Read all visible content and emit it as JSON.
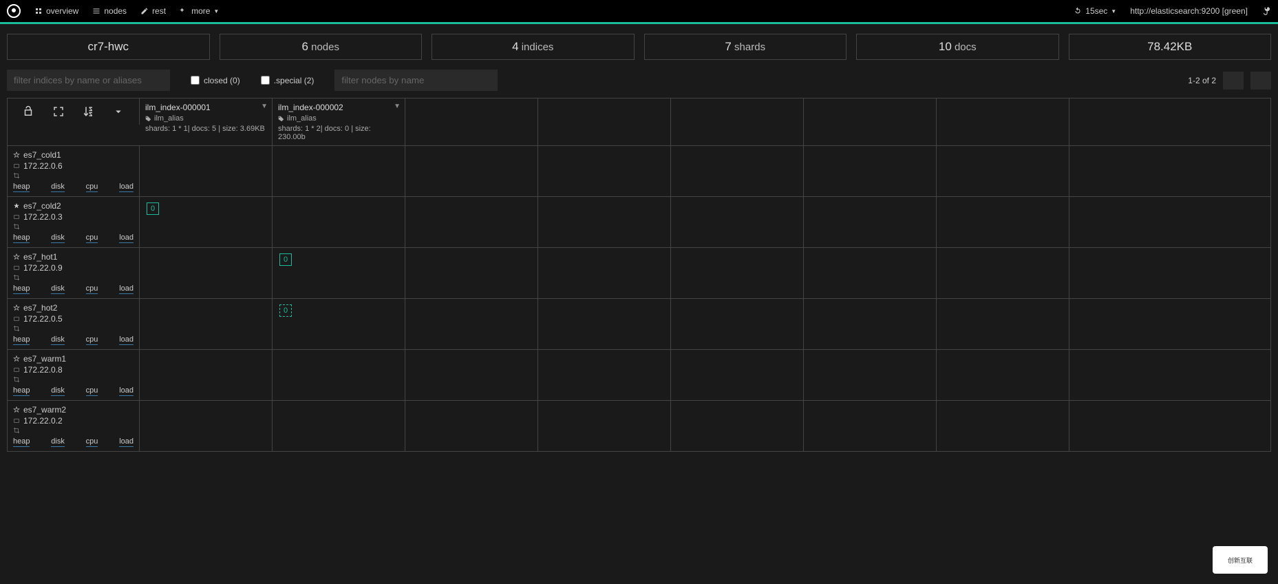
{
  "nav": {
    "overview": "overview",
    "nodes": "nodes",
    "rest": "rest",
    "more": "more",
    "refresh": "15sec",
    "host": "http://elasticsearch:9200 [green]"
  },
  "cluster": {
    "name": "cr7-hwc",
    "nodes_count": "6",
    "nodes_label": "nodes",
    "indices_count": "4",
    "indices_label": "indices",
    "shards_count": "7",
    "shards_label": "shards",
    "docs_count": "10",
    "docs_label": "docs",
    "size": "78.42KB"
  },
  "filters": {
    "indices_placeholder": "filter indices by name or aliases",
    "nodes_placeholder": "filter nodes by name",
    "closed_label": "closed (0)",
    "special_label": ".special (2)",
    "pagination": "1-2 of 2"
  },
  "indices": [
    {
      "name": "ilm_index-000001",
      "alias": "ilm_alias",
      "stats": "shards: 1 * 1| docs: 5 | size: 3.69KB"
    },
    {
      "name": "ilm_index-000002",
      "alias": "ilm_alias",
      "stats": "shards: 1 * 2| docs: 0 | size: 230.00b"
    }
  ],
  "nodes": [
    {
      "name": "es7_cold1",
      "ip": "172.22.0.6",
      "starred": false
    },
    {
      "name": "es7_cold2",
      "ip": "172.22.0.3",
      "starred": true
    },
    {
      "name": "es7_hot1",
      "ip": "172.22.0.9",
      "starred": false
    },
    {
      "name": "es7_hot2",
      "ip": "172.22.0.5",
      "starred": false
    },
    {
      "name": "es7_warm1",
      "ip": "172.22.0.8",
      "starred": false
    },
    {
      "name": "es7_warm2",
      "ip": "172.22.0.2",
      "starred": false
    }
  ],
  "metrics": {
    "heap": "heap",
    "disk": "disk",
    "cpu": "cpu",
    "load": "load"
  },
  "shards": {
    "es7_cold2_idx0": "0",
    "es7_hot1_idx1": "0",
    "es7_hot2_idx1": "0"
  },
  "watermark": "创新互联"
}
